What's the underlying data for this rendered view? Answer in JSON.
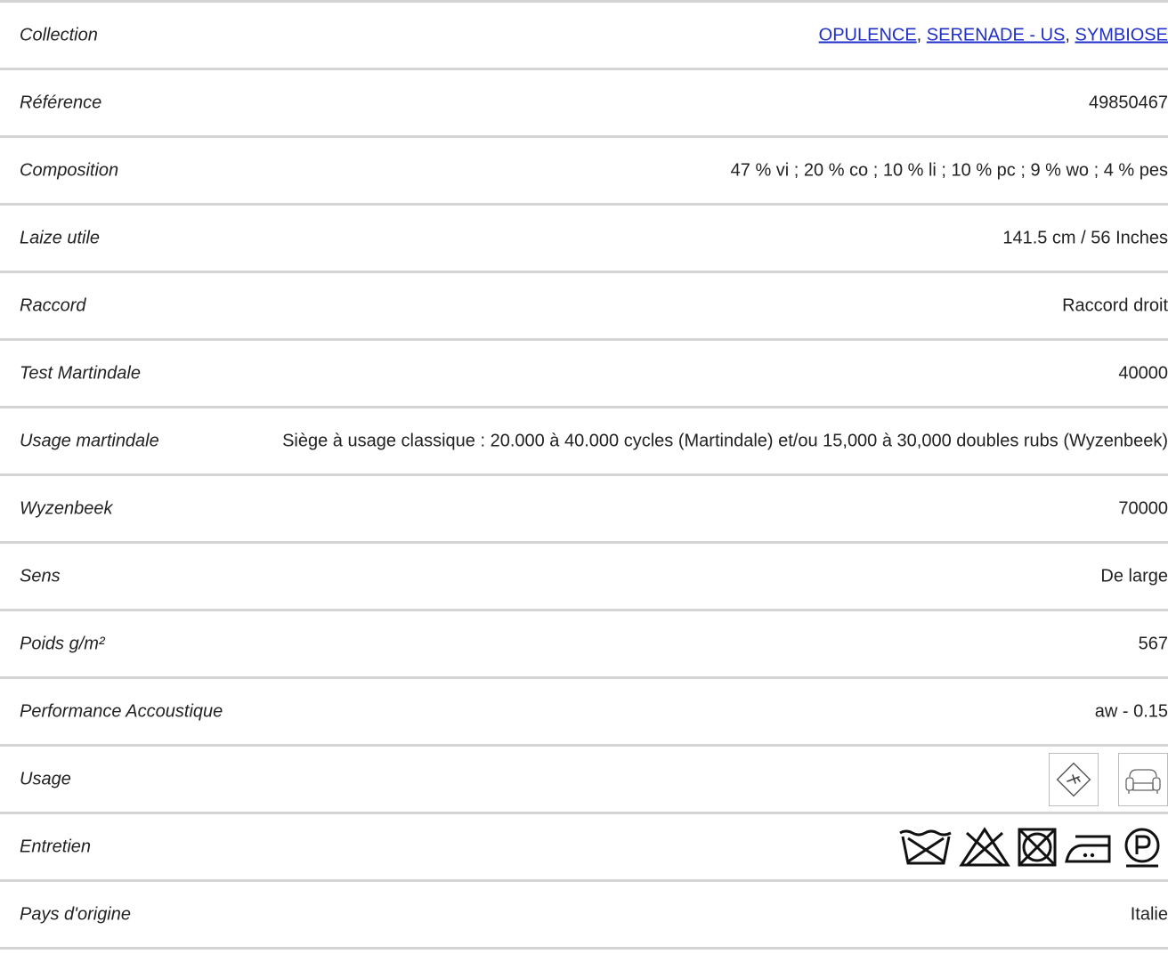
{
  "specs": {
    "collection": {
      "label": "Collection",
      "links": [
        "OPULENCE",
        "SERENADE - US",
        "SYMBIOSE"
      ],
      "separator": ","
    },
    "reference": {
      "label": "Référence",
      "value": "49850467"
    },
    "composition": {
      "label": "Composition",
      "value": "47 % vi ; 20 % co ; 10 % li ; 10 % pc ; 9 % wo ; 4 % pes"
    },
    "laize": {
      "label": "Laize utile",
      "value": "141.5 cm / 56 Inches"
    },
    "raccord": {
      "label": "Raccord",
      "value": "Raccord droit"
    },
    "martindale": {
      "label": "Test Martindale",
      "value": "40000"
    },
    "usage_martindale": {
      "label": "Usage martindale",
      "value": "Siège à usage classique : 20.000 à 40.000 cycles (Martindale) et/ou 15,000 à 30,000 doubles rubs (Wyzenbeek)"
    },
    "wyzenbeek": {
      "label": "Wyzenbeek",
      "value": "70000"
    },
    "sens": {
      "label": "Sens",
      "value": "De large"
    },
    "poids": {
      "label": "Poids g/m²",
      "value": "567"
    },
    "acoustique": {
      "label": "Performance Accoustique",
      "value": "aw - 0.15"
    },
    "usage": {
      "label": "Usage",
      "icons": [
        "airplane-usage-icon",
        "armchair-usage-icon"
      ]
    },
    "entretien": {
      "label": "Entretien",
      "icons": [
        "do-not-wash-icon",
        "do-not-bleach-icon",
        "do-not-tumble-dry-icon",
        "iron-medium-icon",
        "dry-clean-p-icon"
      ]
    },
    "origine": {
      "label": "Pays d'origine",
      "value": "Italie"
    }
  },
  "colors": {
    "link": "#1f2fc9",
    "divider": "#d4d4d4",
    "text": "#222222"
  }
}
